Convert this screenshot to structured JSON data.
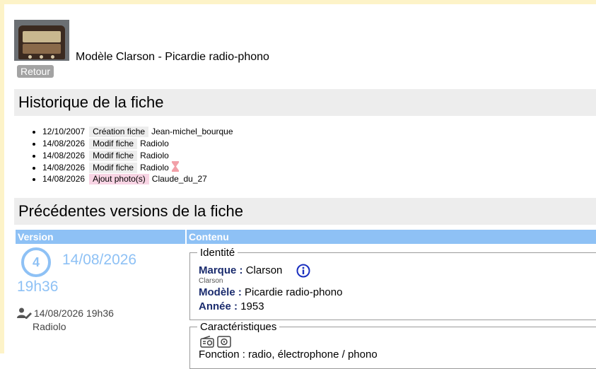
{
  "header": {
    "model_title": "Modèle Clarson - Picardie radio-phono",
    "back_label": "Retour"
  },
  "history": {
    "title": "Historique de la fiche",
    "entries": [
      {
        "date": "12/10/2007",
        "action": "Création fiche",
        "user": "Jean-michel_bourque"
      },
      {
        "date": "14/08/2026",
        "action": "Modif fiche",
        "user": "Radiolo"
      },
      {
        "date": "14/08/2026",
        "action": "Modif fiche",
        "user": "Radiolo"
      },
      {
        "date": "14/08/2026",
        "action": "Modif fiche",
        "user": "Radiolo",
        "icon": "hourglass-icon"
      },
      {
        "date": "14/08/2026",
        "action": "Ajout photo(s)",
        "user": "Claude_du_27"
      }
    ]
  },
  "versions": {
    "title": "Précédentes versions de la fiche",
    "col_version": "Version",
    "col_contenu": "Contenu",
    "current": {
      "number": "4",
      "date": "14/08/2026",
      "time": "19h36",
      "editor_datetime": "14/08/2026 19h36",
      "editor_name": "Radiolo"
    }
  },
  "identite": {
    "legend": "Identité",
    "marque_label": "Marque :",
    "marque_value": "Clarson",
    "marque_sub": "Clarson",
    "modele_label": "Modèle :",
    "modele_value": "Picardie radio-phono",
    "annee_label": "Année :",
    "annee_value": "1953"
  },
  "caracteristiques": {
    "legend": "Caractéristiques",
    "icons": [
      "radio-icon",
      "speaker-icon"
    ],
    "partial_line": "Fonction : radio, électrophone / phono"
  },
  "colors": {
    "accent": "#8ec1f5",
    "label": "#1b2c6e",
    "section_bg": "#ededed",
    "photo_tag": "#f8d4e4",
    "frame": "#fdf3c8"
  }
}
